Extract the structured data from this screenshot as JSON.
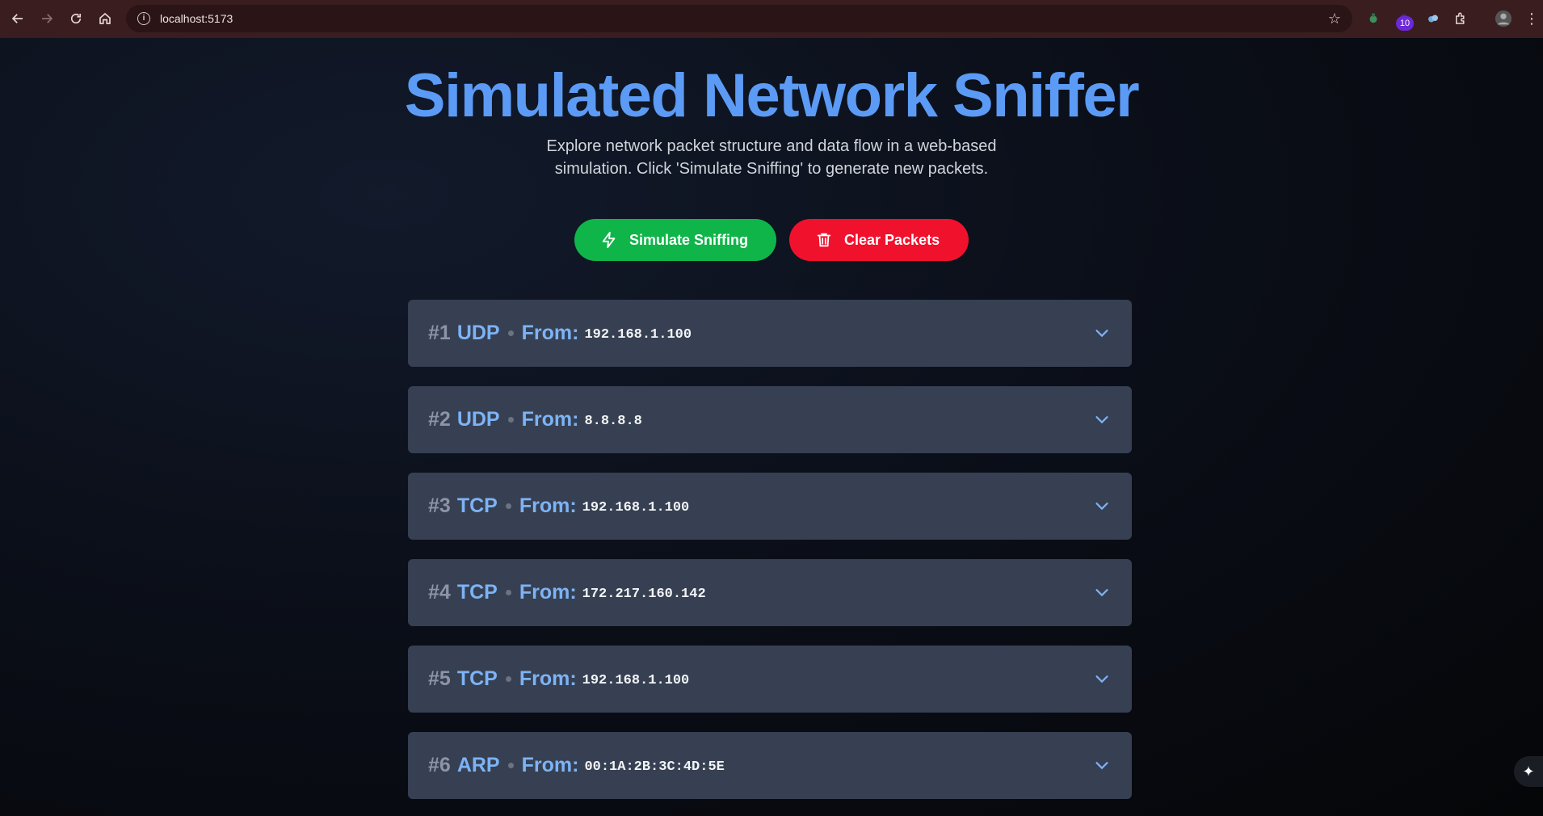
{
  "browser": {
    "url": "localhost:5173",
    "extension_badge": "10"
  },
  "page": {
    "title": "Simulated Network Sniffer",
    "subtitle": "Explore network packet structure and data flow in a web-based simulation. Click 'Simulate Sniffing' to generate new packets.",
    "actions": {
      "simulate_label": "Simulate Sniffing",
      "clear_label": "Clear Packets"
    },
    "from_label": "From:",
    "packets": [
      {
        "num": "#1",
        "protocol": "UDP",
        "from": "192.168.1.100"
      },
      {
        "num": "#2",
        "protocol": "UDP",
        "from": "8.8.8.8"
      },
      {
        "num": "#3",
        "protocol": "TCP",
        "from": "192.168.1.100"
      },
      {
        "num": "#4",
        "protocol": "TCP",
        "from": "172.217.160.142"
      },
      {
        "num": "#5",
        "protocol": "TCP",
        "from": "192.168.1.100"
      },
      {
        "num": "#6",
        "protocol": "ARP",
        "from": "00:1A:2B:3C:4D:5E"
      }
    ]
  },
  "colors": {
    "title": "#5b9bf5",
    "simulate_button": "#10b54a",
    "clear_button": "#f0112d",
    "packet_card": "#364052",
    "accent": "#7db3f5"
  }
}
